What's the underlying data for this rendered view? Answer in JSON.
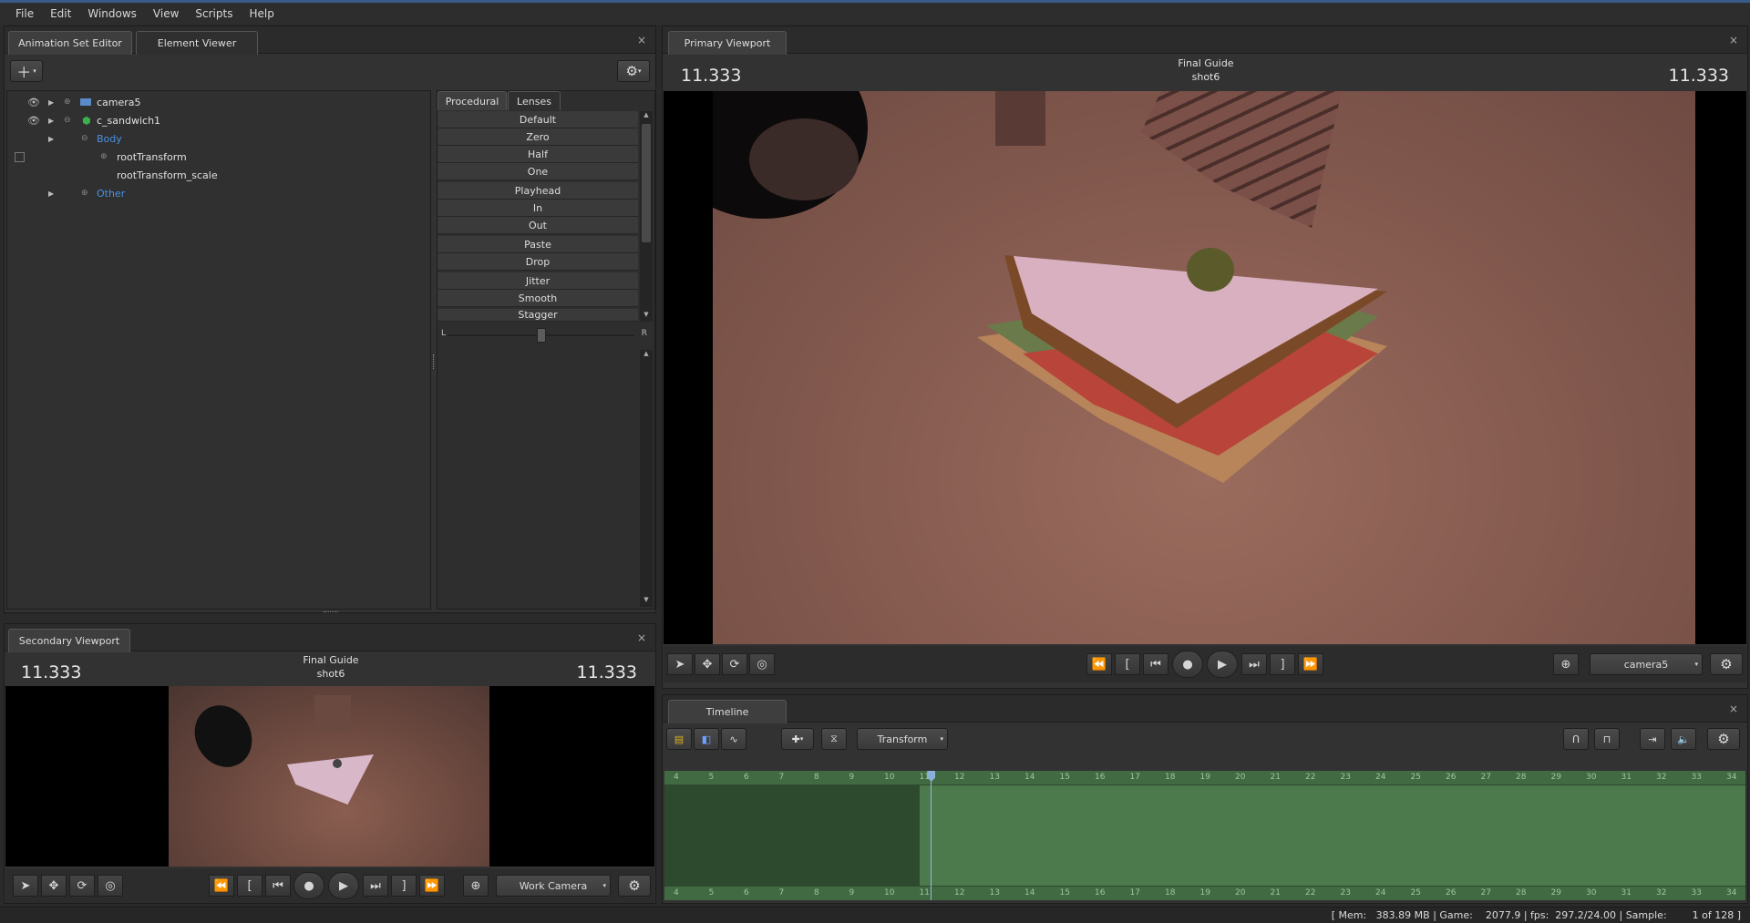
{
  "menu": [
    "File",
    "Edit",
    "Windows",
    "View",
    "Scripts",
    "Help"
  ],
  "anim_panel": {
    "tabs": [
      "Animation Set Editor",
      "Element Viewer"
    ],
    "tree": [
      {
        "label": "camera5",
        "color": "#e0e0e0"
      },
      {
        "label": "c_sandwich1",
        "color": "#e0e0e0"
      },
      {
        "label": "Body",
        "color": "#4a90e2"
      },
      {
        "label": "rootTransform",
        "color": "#e0e0e0"
      },
      {
        "label": "rootTransform_scale",
        "color": "#e0e0e0"
      },
      {
        "label": "Other",
        "color": "#4a90e2"
      }
    ],
    "proc_tabs": [
      "Procedural",
      "Lenses"
    ],
    "proc_items": [
      "Default",
      "Zero",
      "Half",
      "One",
      "Playhead",
      "In",
      "Out",
      "Paste",
      "Drop",
      "Jitter",
      "Smooth",
      "Stagger"
    ],
    "slider_left": "L",
    "slider_right": "R",
    "slider_value": 0.5
  },
  "secondary": {
    "tab": "Secondary Viewport",
    "time_left": "11.333",
    "time_right": "11.333",
    "guide": "Final Guide",
    "shot": "shot6",
    "camera": "Work Camera"
  },
  "primary": {
    "tab": "Primary Viewport",
    "time_left": "11.333",
    "time_right": "11.333",
    "guide": "Final Guide",
    "shot": "shot6",
    "camera": "camera5"
  },
  "timeline": {
    "tab": "Timeline",
    "mode": "Transform",
    "ticks": [
      "4",
      "5",
      "6",
      "7",
      "8",
      "9",
      "10",
      "11",
      "12",
      "13",
      "14",
      "15",
      "16",
      "17",
      "18",
      "19",
      "20",
      "21",
      "22",
      "23",
      "24",
      "25",
      "26",
      "27",
      "28",
      "29",
      "30",
      "31",
      "32",
      "33",
      "34"
    ],
    "playhead": 11.333,
    "dark_end": 11
  },
  "status": {
    "text": "[ Mem:   383.89 MB | Game:    2077.9 | fps:  297.2/24.00 | Sample:        1 of 128 ]"
  },
  "colors": {
    "accent": "#3a5a8a",
    "timeline_green": "#4c7a4c",
    "tree_blue": "#4a90e2"
  }
}
